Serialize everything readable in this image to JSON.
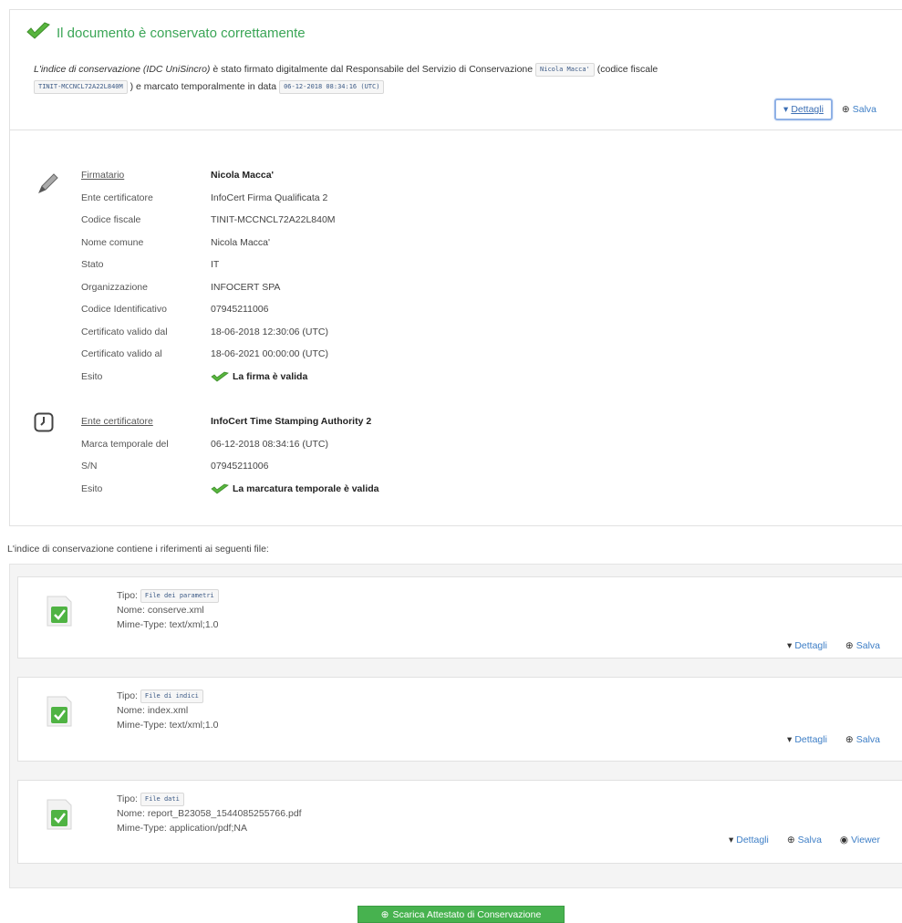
{
  "colors": {
    "success": "#3aa556",
    "link": "#3d7ec6",
    "button_green": "#47b24f"
  },
  "status": {
    "icon": "check-icon",
    "title": "Il documento è conservato correttamente",
    "text_italic": "L'indice di conservazione (IDC UniSincro)",
    "text_1": " è stato firmato digitalmente dal Responsabile del Servizio di Conservazione ",
    "responsabile_chip": "Nicola Macca'",
    "text_2": " (codice fiscale ",
    "codice_chip": "TINIT-MCCNCL72A22L840M",
    "text_3": " ) e marcato temporalmente in data ",
    "data_chip": "06-12-2018 08:34:16 (UTC)",
    "dettagli_label": "Dettagli",
    "salva_label": "Salva"
  },
  "signature": {
    "icon": "pen-icon",
    "rows": [
      {
        "k": "Firmatario",
        "v": "Nicola Macca'"
      },
      {
        "k": "Ente certificatore",
        "v": "InfoCert Firma Qualificata 2"
      },
      {
        "k": "Codice fiscale",
        "v": "TINIT-MCCNCL72A22L840M"
      },
      {
        "k": "Nome comune",
        "v": "Nicola Macca'"
      },
      {
        "k": "Stato",
        "v": "IT"
      },
      {
        "k": "Organizzazione",
        "v": "INFOCERT SPA"
      },
      {
        "k": "Codice Identificativo",
        "v": "07945211006"
      },
      {
        "k": "Certificato valido dal",
        "v": "18-06-2018 12:30:06 (UTC)"
      },
      {
        "k": "Certificato valido al",
        "v": "18-06-2021 00:00:00 (UTC)"
      },
      {
        "k": "Esito",
        "v": "La firma è valida"
      }
    ]
  },
  "timestamp": {
    "icon": "clock-icon",
    "rows": [
      {
        "k": "Ente certificatore",
        "v": "InfoCert Time Stamping Authority 2"
      },
      {
        "k": "Marca temporale del",
        "v": "06-12-2018 08:34:16 (UTC)"
      },
      {
        "k": "S/N",
        "v": "07945211006"
      },
      {
        "k": "Esito",
        "v": "La marcatura temporale è valida"
      }
    ]
  },
  "files_caption": "L'indice di conservazione contiene i riferimenti ai seguenti file:",
  "files": [
    {
      "tipo_label": "Tipo:",
      "tipo": "File dei parametri",
      "nome": "Nome: conserve.xml",
      "mime": "Mime-Type: text/xml;1.0",
      "dettagli": "Dettagli",
      "salva": "Salva"
    },
    {
      "tipo_label": "Tipo:",
      "tipo": "File di indici",
      "nome": "Nome: index.xml",
      "mime": "Mime-Type: text/xml;1.0",
      "dettagli": "Dettagli",
      "salva": "Salva"
    },
    {
      "tipo_label": "Tipo:",
      "tipo": "File dati",
      "nome": "Nome: report_B23058_1544085255766.pdf",
      "mime": "Mime-Type: application/pdf;NA",
      "dettagli": "Dettagli",
      "salva": "Salva",
      "viewer": "Viewer"
    }
  ],
  "download_button": "Scarica Attestato di Conservazione"
}
